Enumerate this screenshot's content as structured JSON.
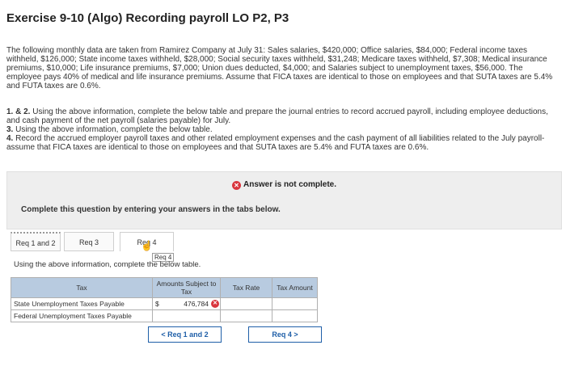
{
  "title": "Exercise 9-10 (Algo) Recording payroll LO P2, P3",
  "problem_text": "The following monthly data are taken from Ramirez Company at July 31: Sales salaries, $420,000; Office salaries, $84,000; Federal income taxes withheld, $126,000; State income taxes withheld, $28,000; Social security taxes withheld, $31,248; Medicare taxes withheld, $7,308; Medical insurance premiums, $10,000; Life insurance premiums, $7,000; Union dues deducted, $4,000; and Salaries subject to unemployment taxes, $56,000. The employee pays 40% of medical and life insurance premiums. Assume that FICA taxes are identical to those on employees and that SUTA taxes are 5.4% and FUTA taxes are 0.6%.",
  "steps": [
    {
      "num": "1. & 2.",
      "text": "Using the above information, complete the below table and prepare the journal entries to record accrued payroll, including employee deductions, and cash payment of the net payroll (salaries payable) for July."
    },
    {
      "num": "3.",
      "text": "Using the above information, complete the below table."
    },
    {
      "num": "4.",
      "text": "Record the accrued employer payroll taxes and other related employment expenses and the cash payment of all liabilities related to the July payroll-assume that FICA taxes are identical to those on employees and that SUTA taxes are 5.4% and FUTA taxes are 0.6%."
    }
  ],
  "alert": "Answer is not complete.",
  "complete_msg": "Complete this question by entering your answers in the tabs below.",
  "tabs": [
    "Req 1 and 2",
    "Req 3",
    "Req 4"
  ],
  "tooltip": "Req 4",
  "instruction": "Using the above information, complete the below table.",
  "table": {
    "headers": [
      "Tax",
      "Amounts Subject to Tax",
      "Tax Rate",
      "Tax Amount"
    ],
    "rows": [
      {
        "tax": "State Unemployment Taxes Payable",
        "currency": "$",
        "amount": "476,784",
        "rate": "",
        "tax_amount": ""
      },
      {
        "tax": "Federal Unemployment Taxes Payable",
        "currency": "",
        "amount": "",
        "rate": "",
        "tax_amount": ""
      }
    ]
  },
  "nav": {
    "prev": "< Req 1 and 2",
    "next": "Req 4 >"
  },
  "colors": {
    "accent": "#1f5fa8",
    "error": "#d9363e",
    "header_bg": "#b8cbe0"
  }
}
